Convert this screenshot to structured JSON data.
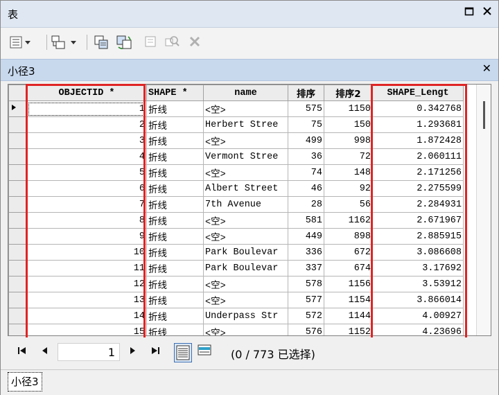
{
  "window": {
    "title": "表"
  },
  "layer": {
    "name": "小径3"
  },
  "columns": [
    "OBJECTID *",
    "SHAPE *",
    "name",
    "排序",
    "排序2",
    "SHAPE_Lengt"
  ],
  "rows": [
    {
      "id": "1",
      "shape": "折线",
      "name": "<空>",
      "sort": "575",
      "sort2": "1150",
      "len": "0.342768"
    },
    {
      "id": "2",
      "shape": "折线",
      "name": "Herbert Stree",
      "sort": "75",
      "sort2": "150",
      "len": "1.293681"
    },
    {
      "id": "3",
      "shape": "折线",
      "name": "<空>",
      "sort": "499",
      "sort2": "998",
      "len": "1.872428"
    },
    {
      "id": "4",
      "shape": "折线",
      "name": "Vermont Stree",
      "sort": "36",
      "sort2": "72",
      "len": "2.060111"
    },
    {
      "id": "5",
      "shape": "折线",
      "name": "<空>",
      "sort": "74",
      "sort2": "148",
      "len": "2.171256"
    },
    {
      "id": "6",
      "shape": "折线",
      "name": "Albert Street",
      "sort": "46",
      "sort2": "92",
      "len": "2.275599"
    },
    {
      "id": "7",
      "shape": "折线",
      "name": "7th Avenue",
      "sort": "28",
      "sort2": "56",
      "len": "2.284931"
    },
    {
      "id": "8",
      "shape": "折线",
      "name": "<空>",
      "sort": "581",
      "sort2": "1162",
      "len": "2.671967"
    },
    {
      "id": "9",
      "shape": "折线",
      "name": "<空>",
      "sort": "449",
      "sort2": "898",
      "len": "2.885915"
    },
    {
      "id": "10",
      "shape": "折线",
      "name": "Park Boulevar",
      "sort": "336",
      "sort2": "672",
      "len": "3.086608"
    },
    {
      "id": "11",
      "shape": "折线",
      "name": "Park Boulevar",
      "sort": "337",
      "sort2": "674",
      "len": "3.17692"
    },
    {
      "id": "12",
      "shape": "折线",
      "name": "<空>",
      "sort": "578",
      "sort2": "1156",
      "len": "3.53912"
    },
    {
      "id": "13",
      "shape": "折线",
      "name": "<空>",
      "sort": "577",
      "sort2": "1154",
      "len": "3.866014"
    },
    {
      "id": "14",
      "shape": "折线",
      "name": "Underpass Str",
      "sort": "572",
      "sort2": "1144",
      "len": "4.00927"
    },
    {
      "id": "15",
      "shape": "折线",
      "name": "<空>",
      "sort": "576",
      "sort2": "1152",
      "len": "4.23696"
    }
  ],
  "nav": {
    "current_record": "1",
    "selection_status": "(0 / 773 已选择)"
  },
  "tab": {
    "label": "小径3"
  },
  "colors": {
    "highlight": "#e02424",
    "title_bar": "#dfe7f3",
    "layer_bar": "#c8d9ee"
  },
  "icons": [
    "table-options-icon",
    "related-tables-icon",
    "select-by-attributes-icon",
    "switch-selection-icon",
    "clear-selection-icon",
    "zoom-to-selected-icon",
    "delete-selected-icon",
    "show-all-records-icon",
    "show-selected-records-icon"
  ]
}
